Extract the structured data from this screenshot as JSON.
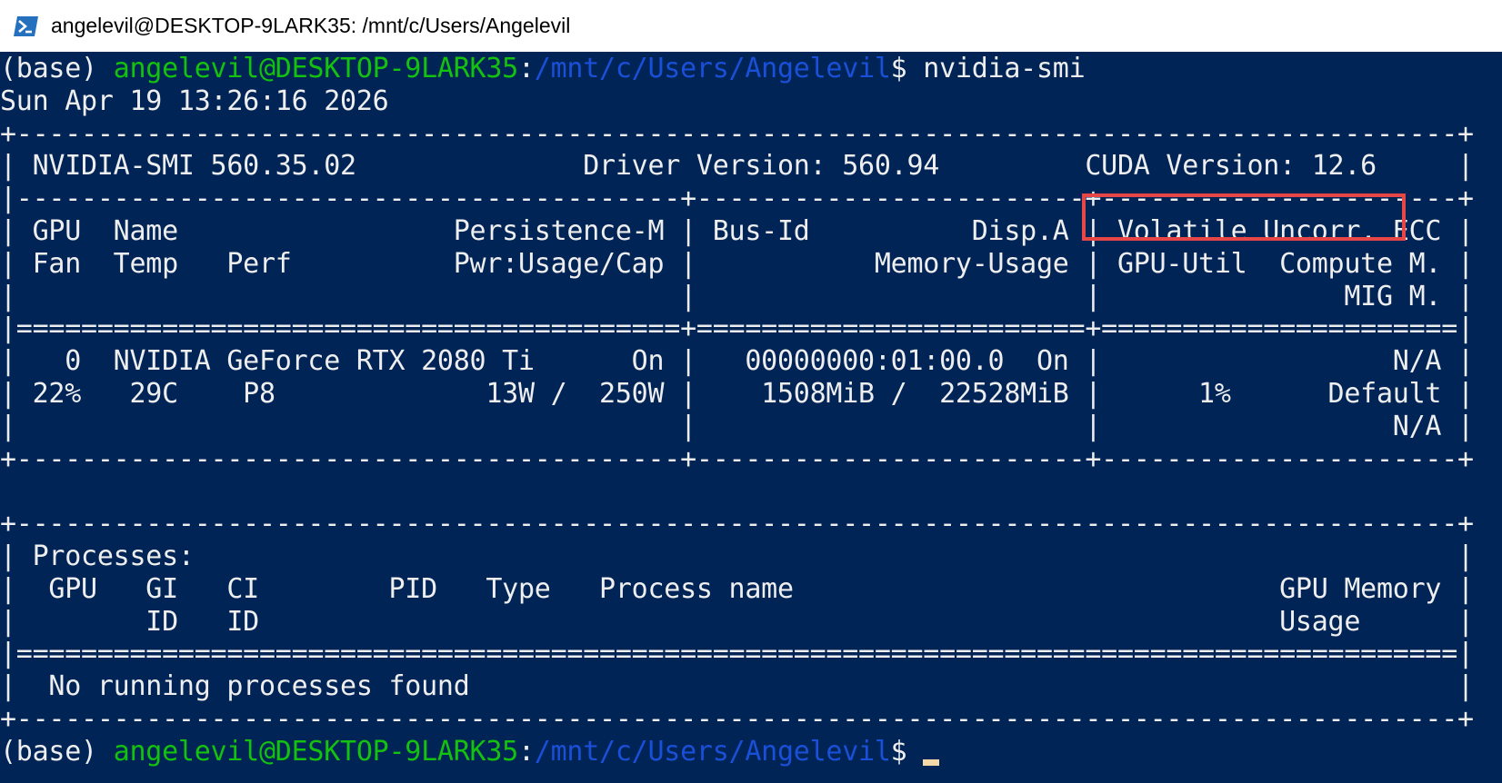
{
  "window": {
    "title": "angelevil@DESKTOP-9LARK35: /mnt/c/Users/Angelevil",
    "icon": "powershell-icon"
  },
  "prompt": {
    "env": "(base)",
    "user_host": "angelevil@DESKTOP-9LARK35",
    "colon": ":",
    "path": "/mnt/c/Users/Angelevil",
    "dollar": "$",
    "command": " nvidia-smi"
  },
  "output": {
    "date_line": "Sun Apr 19 13:26:16 2026",
    "border_top": "+-----------------------------------------------------------------------------------------+",
    "header_left": "| NVIDIA-SMI 560.35.02              Driver Version: 560.94         ",
    "cuda_version": "CUDA Version: 12.6",
    "header_right": "     |",
    "sep1": "|-----------------------------------------+------------------------+----------------------+",
    "col_hdr1": "| GPU  Name                 Persistence-M | Bus-Id          Disp.A | Volatile Uncorr. ECC |",
    "col_hdr2": "| Fan  Temp   Perf          Pwr:Usage/Cap |           Memory-Usage | GPU-Util  Compute M. |",
    "col_hdr3": "|                                         |                        |               MIG M. |",
    "sep_eq1": "|=========================================+========================+======================|",
    "gpu_row1": "|   0  NVIDIA GeForce RTX 2080 Ti      On |   00000000:01:00.0  On |                  N/A |",
    "gpu_row2": "| 22%   29C    P8             13W /  250W |    1508MiB /  22528MiB |      1%      Default |",
    "gpu_row3": "|                                         |                        |                  N/A |",
    "border_mid": "+-----------------------------------------+------------------------+----------------------+",
    "blank": "",
    "proc_border_top": "+-----------------------------------------------------------------------------------------+",
    "proc_title": "| Processes:                                                                              |",
    "proc_hdr1": "|  GPU   GI   CI        PID   Type   Process name                              GPU Memory |",
    "proc_hdr2": "|        ID   ID                                                               Usage      |",
    "proc_sep_eq": "|=========================================================================================|",
    "proc_none": "|  No running processes found                                                             |",
    "proc_border_bottom": "+-----------------------------------------------------------------------------------------+"
  },
  "colors": {
    "terminal_bg": "#012456",
    "user_host": "#13c10e",
    "path": "#1a4fd8",
    "highlight": "#e74646"
  }
}
